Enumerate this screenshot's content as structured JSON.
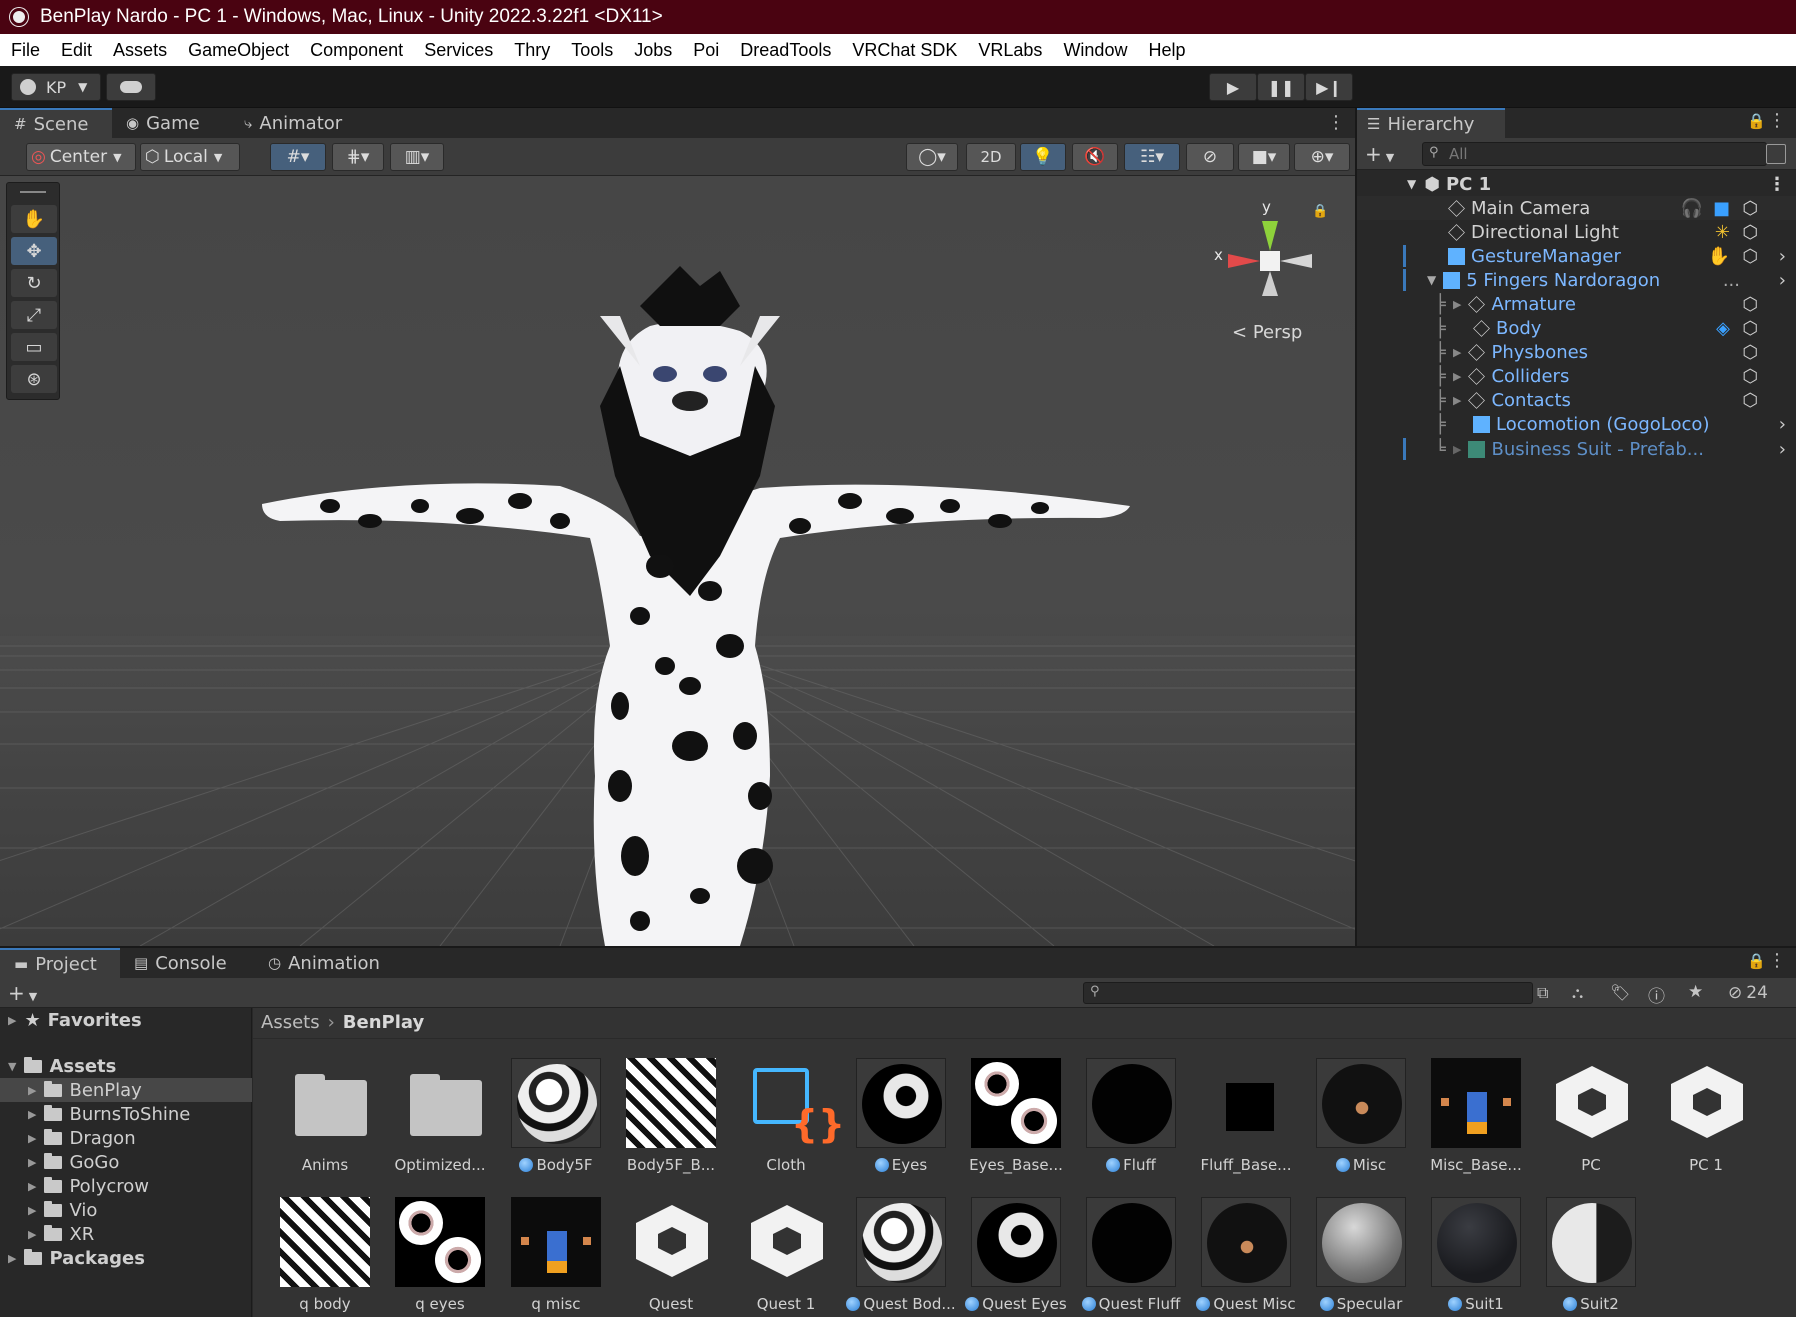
{
  "window": {
    "title": "BenPlay Nardo - PC 1 - Windows, Mac, Linux - Unity 2022.3.22f1 <DX11>"
  },
  "menu": [
    "File",
    "Edit",
    "Assets",
    "GameObject",
    "Component",
    "Services",
    "Thry",
    "Tools",
    "Jobs",
    "Poi",
    "DreadTools",
    "VRChat SDK",
    "VRLabs",
    "Window",
    "Help"
  ],
  "toolbar": {
    "account": "KP"
  },
  "scene_tabs": [
    "Scene",
    "Game",
    "Animator"
  ],
  "scene_toolbar": {
    "pivot": "Center",
    "space": "Local",
    "mode_2d": "2D"
  },
  "gizmo": {
    "y": "y",
    "x": "x",
    "projection": "Persp"
  },
  "hierarchy": {
    "title": "Hierarchy",
    "search_placeholder": "All",
    "root": "PC 1",
    "items": [
      {
        "label": "Main Camera",
        "type": "normal"
      },
      {
        "label": "Directional Light",
        "type": "normal"
      },
      {
        "label": "GestureManager",
        "type": "prefab"
      },
      {
        "label": "5 Fingers Nardoragon",
        "type": "prefab",
        "extra": "..."
      },
      {
        "label": "Armature",
        "type": "prefab"
      },
      {
        "label": "Body",
        "type": "prefab"
      },
      {
        "label": "Physbones",
        "type": "prefab"
      },
      {
        "label": "Colliders",
        "type": "prefab"
      },
      {
        "label": "Contacts",
        "type": "prefab"
      },
      {
        "label": "Locomotion (GogoLoco)",
        "type": "prefab"
      },
      {
        "label": "Business Suit - Prefab...",
        "type": "dim"
      }
    ]
  },
  "bottom_tabs": [
    "Project",
    "Console",
    "Animation"
  ],
  "project": {
    "hidden_count": "24",
    "favorites": "Favorites",
    "assets_root": "Assets",
    "folders": [
      "BenPlay",
      "BurnsToShine",
      "Dragon",
      "GoGo",
      "Polycrow",
      "Vio",
      "XR"
    ],
    "packages": "Packages",
    "breadcrumb": [
      "Assets",
      "BenPlay"
    ],
    "assets_row1": [
      "Anims",
      "Optimized...",
      "Body5F",
      "Body5F_B...",
      "Cloth",
      "Eyes",
      "Eyes_Base...",
      "Fluff",
      "Fluff_Base...",
      "Misc",
      "Misc_Base...",
      "PC",
      "PC 1"
    ],
    "assets_row2": [
      "q body",
      "q eyes",
      "q misc",
      "Quest",
      "Quest 1",
      "Quest Bod...",
      "Quest Eyes",
      "Quest Fluff",
      "Quest Misc",
      "Specular",
      "Suit1",
      "Suit2"
    ]
  },
  "colors": {
    "title_bar": "#4a0311",
    "accent": "#3a79bb",
    "prefab_text": "#7cb7ff"
  }
}
